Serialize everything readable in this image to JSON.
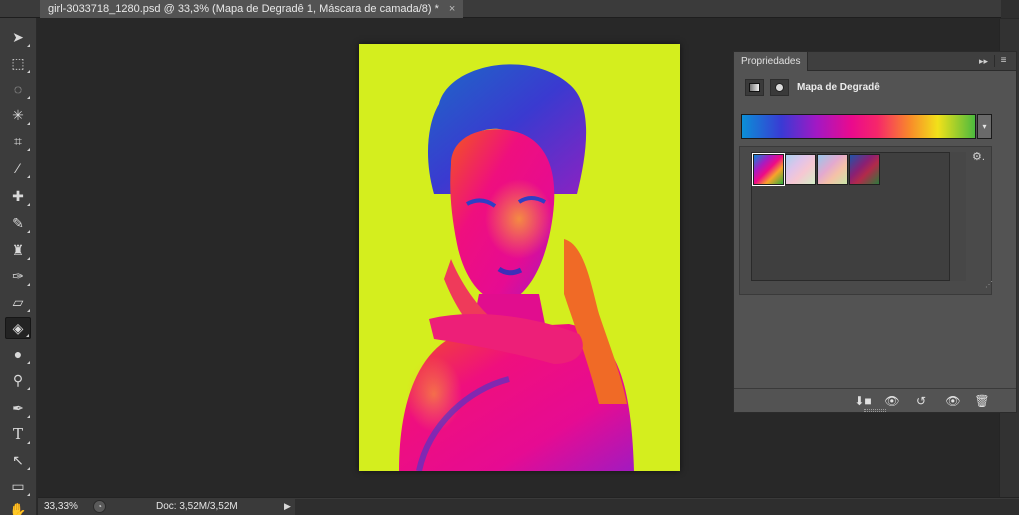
{
  "document_tab": {
    "title": "girl-3033718_1280.psd @ 33,3% (Mapa de Degradê 1, Máscara de camada/8) *",
    "close": "×"
  },
  "tools": [
    {
      "name": "move-tool-icon",
      "glyph": "➤"
    },
    {
      "name": "marquee-tool-icon",
      "glyph": "⬚"
    },
    {
      "name": "lasso-tool-icon",
      "glyph": "◌"
    },
    {
      "name": "magic-wand-tool-icon",
      "glyph": "✳"
    },
    {
      "name": "crop-tool-icon",
      "glyph": "⌗"
    },
    {
      "name": "eyedropper-tool-icon",
      "glyph": "⁄"
    },
    {
      "name": "healing-brush-tool-icon",
      "glyph": "✚"
    },
    {
      "name": "brush-tool-icon",
      "glyph": "✎"
    },
    {
      "name": "clone-stamp-tool-icon",
      "glyph": "♜"
    },
    {
      "name": "history-brush-tool-icon",
      "glyph": "✑"
    },
    {
      "name": "eraser-tool-icon",
      "glyph": "▱"
    },
    {
      "name": "paint-bucket-tool-icon",
      "glyph": "◈"
    },
    {
      "name": "blur-tool-icon",
      "glyph": "●"
    },
    {
      "name": "dodge-tool-icon",
      "glyph": "⚲"
    },
    {
      "name": "pen-tool-icon",
      "glyph": "✒"
    },
    {
      "name": "type-tool-icon",
      "glyph": "T"
    },
    {
      "name": "path-selection-tool-icon",
      "glyph": "↖"
    },
    {
      "name": "rectangle-tool-icon",
      "glyph": "▭"
    },
    {
      "name": "hand-tool-icon",
      "glyph": "✋"
    }
  ],
  "properties_panel": {
    "tab_label": "Propriedades",
    "collapse_glyph": "▸▸",
    "menu_glyph": "≡",
    "title": "Mapa de Degradê",
    "gear_glyph": "⚙.",
    "resize_glyph": "⋰",
    "dropdown_glyph": "▾",
    "footer_icons": {
      "clip": "⬇■",
      "view_previous": "👁",
      "reset": "↺",
      "visibility": "👁",
      "delete": "🗑"
    }
  },
  "status_bar": {
    "zoom": "33,33%",
    "doc_size": "Doc: 3,52M/3,52M",
    "arrow": "▶"
  },
  "colors": {
    "canvas_background": "#d4ee1e",
    "workspace": "#282828",
    "panel": "#535353"
  }
}
